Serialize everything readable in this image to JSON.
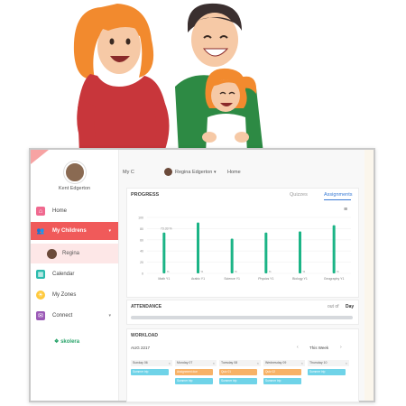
{
  "user": {
    "name": "Kent Edgerton"
  },
  "sidebar": {
    "items": [
      {
        "label": "Home",
        "icon": "home-icon"
      },
      {
        "label": "My Childrens",
        "icon": "people-icon"
      },
      {
        "label": "Regina",
        "icon": "child-avatar"
      },
      {
        "label": "Calendar",
        "icon": "calendar-icon"
      },
      {
        "label": "My Zones",
        "icon": "sun-icon"
      },
      {
        "label": "Connect",
        "icon": "chat-icon"
      }
    ],
    "brand": "skolera"
  },
  "topbar": {
    "back_label": "My C",
    "child_select": "Regina Edgerton",
    "home_link": "Home"
  },
  "progress": {
    "title": "PROGRESS",
    "tabs": [
      "Quizzes",
      "Assignments"
    ],
    "active_tab": "Assignments"
  },
  "chart_data": {
    "type": "bar",
    "categories": [
      "Math Y1",
      "Arabic Y1",
      "Science Y1",
      "Physics Y1",
      "Biology Y1",
      "Geography Y1"
    ],
    "values": [
      73,
      91,
      62,
      73,
      75,
      86
    ],
    "ylim": [
      0,
      100
    ],
    "yticks": [
      0,
      20,
      40,
      60,
      80,
      100
    ],
    "annotation": "73.33 %",
    "accent": "#1bb486"
  },
  "attendance": {
    "title": "ATTENDANCE",
    "out_of": "out of",
    "period": "Day"
  },
  "workload": {
    "title": "WORKLOAD",
    "month": "AUG 2217",
    "range": "This Week",
    "days": [
      {
        "label": "Sunday 06",
        "events": [
          {
            "text": "Summer trip",
            "color": "#6fd3e8"
          }
        ]
      },
      {
        "label": "Monday 07",
        "events": [
          {
            "text": "Assignment due",
            "color": "#f7b267"
          },
          {
            "text": "Summer trip",
            "color": "#6fd3e8"
          }
        ]
      },
      {
        "label": "Tuesday 08",
        "events": [
          {
            "text": "Quiz 01",
            "color": "#f7b267"
          },
          {
            "text": "Summer trip",
            "color": "#6fd3e8"
          }
        ]
      },
      {
        "label": "Wednesday 09",
        "events": [
          {
            "text": "Quiz 02",
            "color": "#f7b267"
          },
          {
            "text": "Summer trip",
            "color": "#6fd3e8"
          }
        ]
      },
      {
        "label": "Thursday 10",
        "events": [
          {
            "text": "Summer trip",
            "color": "#6fd3e8"
          }
        ]
      }
    ]
  },
  "colors": {
    "primary": "#f05a5a",
    "link": "#3a7bd5",
    "chart": "#1bb486"
  }
}
